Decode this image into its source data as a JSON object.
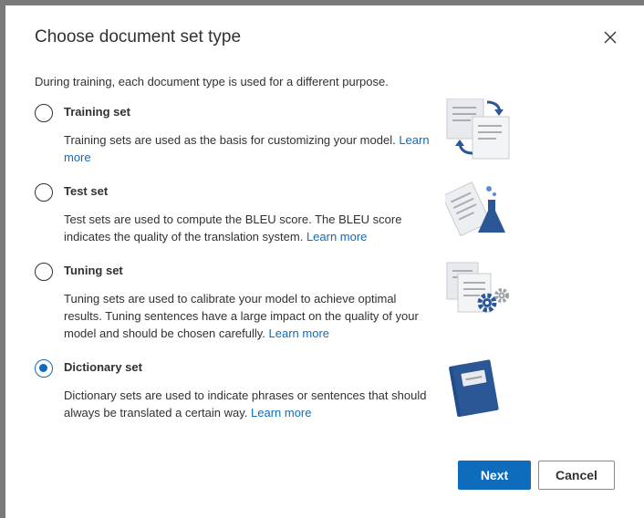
{
  "dialog": {
    "title": "Choose document set type",
    "intro": "During training, each document type is used for a different purpose."
  },
  "options": [
    {
      "label": "Training set",
      "description": "Training sets are used as the basis for customizing your model.",
      "link": "Learn more",
      "selected": false,
      "icon": "training-documents-icon"
    },
    {
      "label": "Test set",
      "description": "Test sets are used to compute the BLEU score. The BLEU score indicates the quality of the translation system.",
      "link": "Learn more",
      "selected": false,
      "icon": "test-flask-icon"
    },
    {
      "label": "Tuning set",
      "description": "Tuning sets are used to calibrate your model to achieve optimal results. Tuning sentences have a large impact on the quality of your model and should be chosen carefully.",
      "link": "Learn more",
      "selected": false,
      "icon": "tuning-gears-icon"
    },
    {
      "label": "Dictionary set",
      "description": "Dictionary sets are used to indicate phrases or sentences that should always be translated a certain way.",
      "link": "Learn more",
      "selected": true,
      "icon": "dictionary-book-icon"
    }
  ],
  "buttons": {
    "next": "Next",
    "cancel": "Cancel"
  },
  "colors": {
    "accent": "#0f6cbd",
    "text": "#323130",
    "overlay": "#7a7a7a"
  }
}
